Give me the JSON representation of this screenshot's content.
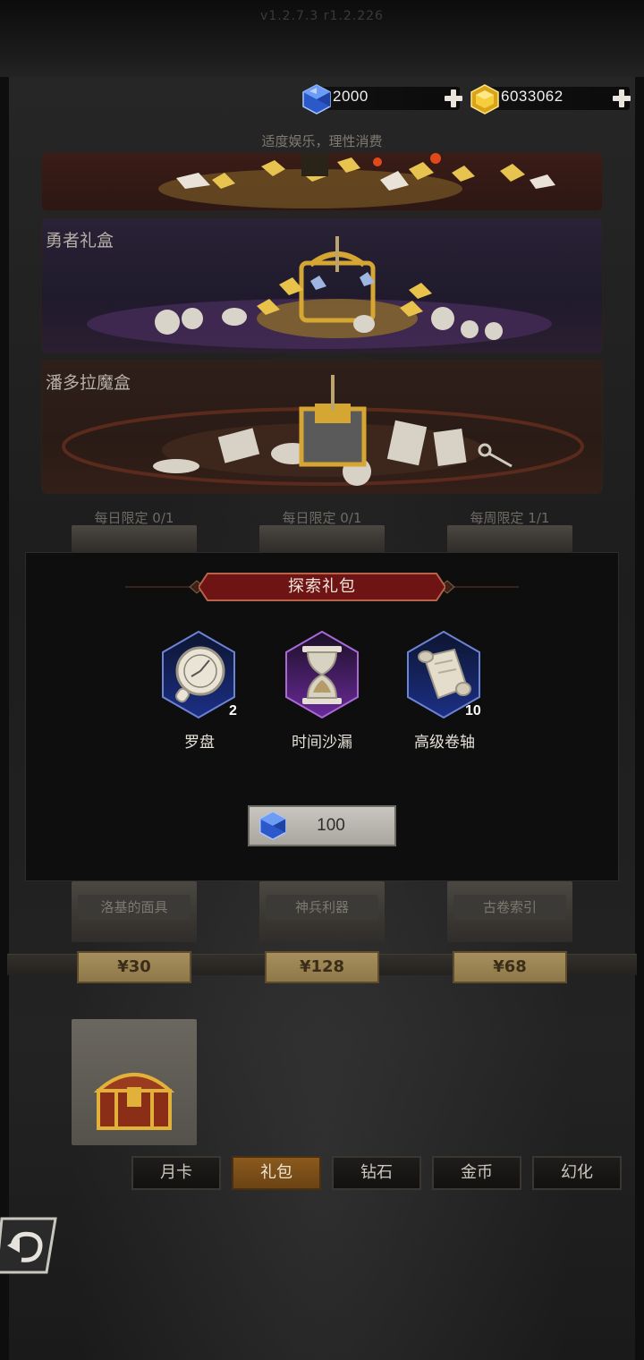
{
  "version": "v1.2.7.3 r1.2.226",
  "currency": {
    "diamonds": "2000",
    "gold": "6033062",
    "diamond_icon": "blue-gem-icon",
    "gold_icon": "gold-gem-icon"
  },
  "notice": "适度娱乐，理性消费",
  "banners": [
    {
      "title": ""
    },
    {
      "title": "勇者礼盒"
    },
    {
      "title": "潘多拉魔盒"
    }
  ],
  "shop": {
    "limits": [
      "每日限定 0/1",
      "每日限定 0/1",
      "每周限定 1/1"
    ],
    "row2_labels": [
      "洛基的面具",
      "神兵利器",
      "古卷索引"
    ],
    "row2_prices": [
      "¥30",
      "¥128",
      "¥68"
    ]
  },
  "modal": {
    "title": "探索礼包",
    "items": [
      {
        "name": "罗盘",
        "count": "2",
        "icon": "compass-icon"
      },
      {
        "name": "时间沙漏",
        "count": "",
        "icon": "hourglass-icon"
      },
      {
        "name": "高级卷轴",
        "count": "10",
        "icon": "scroll-icon"
      }
    ],
    "price": "100"
  },
  "tabs": [
    {
      "label": "月卡",
      "active": false
    },
    {
      "label": "礼包",
      "active": true
    },
    {
      "label": "钻石",
      "active": false
    },
    {
      "label": "金币",
      "active": false
    },
    {
      "label": "幻化",
      "active": false
    }
  ],
  "colors": {
    "accent_tab": "#7a4e18",
    "modal_title_bg": "#7a1616",
    "diamond": "#3a6ee0",
    "gold": "#e8b820",
    "price_plate": "#9c8653"
  }
}
